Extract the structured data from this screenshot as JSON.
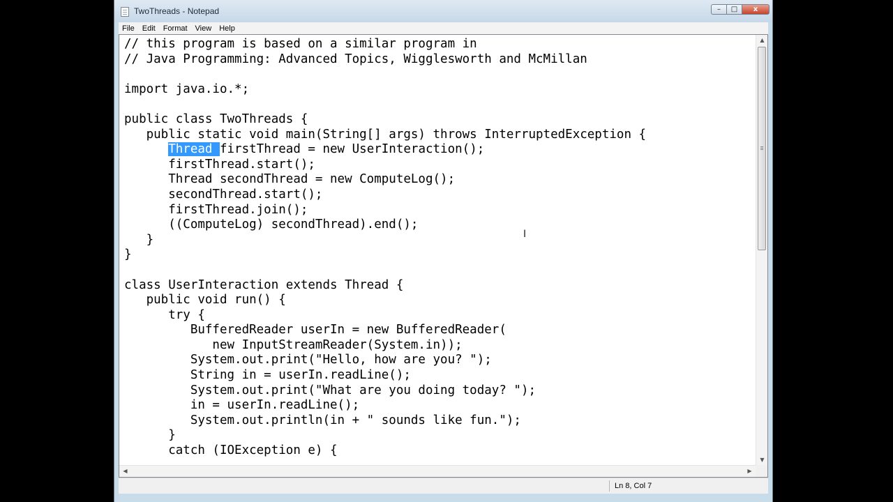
{
  "window": {
    "title": "TwoThreads - Notepad",
    "controls": {
      "minimize": "–",
      "maximize": "□",
      "close": "x"
    }
  },
  "menu": [
    "File",
    "Edit",
    "Format",
    "View",
    "Help"
  ],
  "editor": {
    "selected_text": "Thread ",
    "selection_rest": "firstThread = new UserInteraction();",
    "lines": [
      "// this program is based on a similar program in",
      "// Java Programming: Advanced Topics, Wigglesworth and McMillan",
      "",
      "import java.io.*;",
      "",
      "public class TwoThreads {",
      "   public static void main(String[] args) throws InterruptedException {",
      "      Thread firstThread = new UserInteraction();",
      "      firstThread.start();",
      "      Thread secondThread = new ComputeLog();",
      "      secondThread.start();",
      "      firstThread.join();",
      "      ((ComputeLog) secondThread).end();",
      "   }",
      "}",
      "",
      "class UserInteraction extends Thread {",
      "   public void run() {",
      "      try {",
      "         BufferedReader userIn = new BufferedReader(",
      "            new InputStreamReader(System.in));",
      "         System.out.print(\"Hello, how are you? \");",
      "         String in = userIn.readLine();",
      "         System.out.print(\"What are you doing today? \");",
      "         in = userIn.readLine();",
      "         System.out.println(in + \" sounds like fun.\");",
      "      }",
      "      catch (IOException e) {"
    ]
  },
  "status": {
    "position": "Ln 8, Col 7"
  },
  "icons": {
    "app": "notepad-icon",
    "scroll_up": "▲",
    "scroll_down": "▼",
    "scroll_left": "◀",
    "scroll_right": "▶",
    "cursor": "I"
  }
}
